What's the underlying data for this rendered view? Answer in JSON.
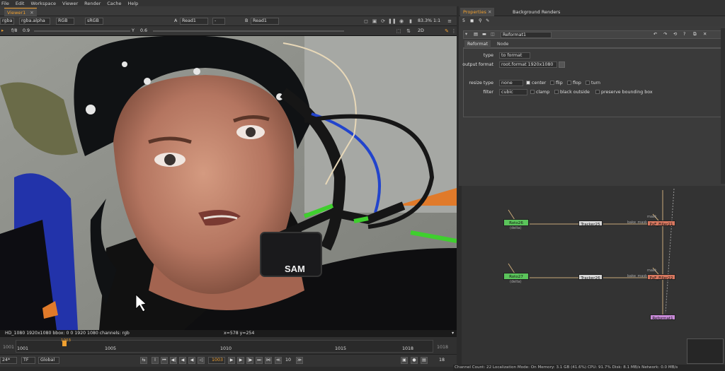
{
  "menu": [
    "File",
    "Edit",
    "Workspace",
    "Viewer",
    "Render",
    "Cache",
    "Help"
  ],
  "viewer_tab": {
    "label": "Viewer1"
  },
  "viewer_controls": {
    "channels": "rgba",
    "layer": "rgba.alpha",
    "display": "RGB",
    "lut": "sRGB",
    "input_a_label": "A",
    "input_a": "Read1",
    "input_a_op": "-",
    "input_b_label": "B",
    "input_b": "Read1",
    "zoom": "83.3%",
    "proxy": "1:1",
    "gain_label": "f/8",
    "gain": "0.9",
    "gamma_label": "Y",
    "gamma": "0.6",
    "view_mode": "2D"
  },
  "viewer_info": {
    "format": "HD_1080 1920x1080  bbox: 0 0 1920 1080 channels: rgb",
    "coords": "x=578 y=254"
  },
  "timeline": {
    "start": "1001",
    "end": "1018",
    "current": "1003",
    "ticks": [
      "1001",
      "1005",
      "1010",
      "1015",
      "1018"
    ],
    "range_start": "1001",
    "range_end": "1018"
  },
  "transport": {
    "fps": "24*",
    "tf": "TF",
    "range_mode": "Global",
    "frame": "1003",
    "increment": "10",
    "end_frame": "18"
  },
  "properties": {
    "tabs": [
      "Properties",
      "Background Renders"
    ],
    "node_name": "Reformat1",
    "node_tabs": [
      "Reformat",
      "Node"
    ],
    "type_label": "type",
    "type_value": "to format",
    "output_format_label": "output format",
    "output_format": "root.format 1920x1080",
    "resize_type_label": "resize type",
    "resize_type": "none",
    "center_label": "center",
    "flip_label": "flip",
    "flop_label": "flop",
    "turn_label": "turn",
    "filter_label": "filter",
    "filter_value": "cubic",
    "clamp_label": "clamp",
    "black_outside_label": "black outside",
    "preserve_bbox_label": "preserve bounding box"
  },
  "graph": {
    "nodes": [
      {
        "label": "Roto26",
        "sub": "(delta)"
      },
      {
        "label": "Tracker25",
        "sub": ""
      },
      {
        "label": "PxF_Filler21",
        "sub": "bake_mask"
      },
      {
        "label": "Roto27",
        "sub": "(delta)"
      },
      {
        "label": "Tracker26",
        "sub": ""
      },
      {
        "label": "PxF_Filler22",
        "sub": "bake_mask"
      },
      {
        "label": "Reformat1",
        "sub": ""
      }
    ],
    "mask_label": "mask"
  },
  "status_bar": "Channel Count: 22  Localization Mode: On  Memory: 3.1 GB (41.6%)  CPU: 91.7%  Disk: 8.1 MB/s  Network: 0.0 MB/s",
  "colors": {
    "accent": "#f0a030",
    "roto_node": "#5bc45b",
    "filler_node": "#d87860",
    "tracker_node": "#d8d8d8",
    "reformat_node": "#c88ad8",
    "headband": "#101214",
    "mocap_green": "#3fcf2e"
  }
}
